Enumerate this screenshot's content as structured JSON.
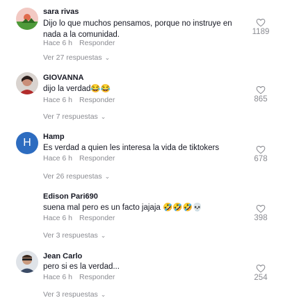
{
  "comments": [
    {
      "username": "sara rivas",
      "text": "Dijo lo que muchos pensamos, porque no instruye en nada a la comunidad.",
      "time": "Hace 6 h",
      "reply_label": "Responder",
      "replies_label": "Ver 27 respuestas",
      "likes": "1189",
      "avatar_icon": "landscape-avatar-icon"
    },
    {
      "username": "GIOVANNA",
      "text": "dijo la verdad😂😂",
      "time": "Hace 6 h",
      "reply_label": "Responder",
      "replies_label": "Ver 7 respuestas",
      "likes": "865",
      "avatar_icon": "profile-photo-avatar-icon"
    },
    {
      "username": "Hamp",
      "text": "Es verdad a quien les interesa la vida de tiktokers",
      "time": "Hace 6 h",
      "reply_label": "Responder",
      "replies_label": "Ver 26 respuestas",
      "likes": "678",
      "avatar_letter": "H",
      "avatar_color": "#2d6cc0"
    },
    {
      "username": "Edison Pari690",
      "text": "suena mal pero es un facto jajaja 🤣🤣🤣💀",
      "time": "Hace 6 h",
      "reply_label": "Responder",
      "replies_label": "Ver 3 respuestas",
      "likes": "398",
      "avatar_icon": "none"
    },
    {
      "username": "Jean Carlo",
      "text": "pero si es la verdad...",
      "time": "Hace 6 h",
      "reply_label": "Responder",
      "replies_label": "Ver 3 respuestas",
      "likes": "254",
      "avatar_icon": "profile-photo-avatar-icon"
    }
  ],
  "colors": {
    "text": "#161823",
    "muted": "#8a8b91",
    "letter_avatar": "#2d6cc0"
  },
  "icons": {
    "like": "heart-outline-icon",
    "expand": "chevron-down-icon"
  }
}
